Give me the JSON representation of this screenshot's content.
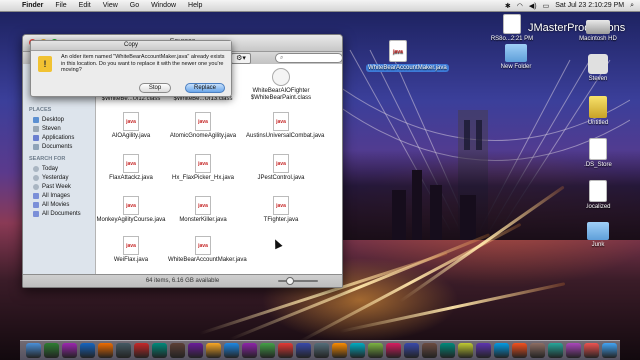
{
  "menubar": {
    "apple": "",
    "items": [
      "Finder",
      "File",
      "Edit",
      "View",
      "Go",
      "Window",
      "Help"
    ],
    "clock": "Sat Jul 23  2:10:29 PM"
  },
  "watermark": "JMasterProductions",
  "desktop_icons": [
    {
      "label": "RS8o...2:21 PM",
      "kind": "file"
    },
    {
      "label": "Macintosh HD",
      "kind": "drive"
    },
    {
      "label": "WhiteBearAccountMaker.java",
      "kind": "java",
      "selected": true
    },
    {
      "label": "New Folder",
      "kind": "folder"
    },
    {
      "label": "Steven",
      "kind": "home"
    },
    {
      "label": "Untitled",
      "kind": "drive"
    },
    {
      "label": ".DS_Store",
      "kind": "file"
    },
    {
      "label": ".localized",
      "kind": "file"
    },
    {
      "label": "Junk",
      "kind": "folder"
    }
  ],
  "finder": {
    "title": "Sources",
    "search_placeholder": "",
    "sidebar": {
      "places_header": "PLACES",
      "places": [
        "Desktop",
        "Steven",
        "Applications",
        "Documents"
      ],
      "search_header": "SEARCH FOR",
      "searches": [
        "Today",
        "Yesterday",
        "Past Week",
        "All Images",
        "All Movies",
        "All Documents"
      ]
    },
    "files": [
      {
        "name": "$WhiteBe...Ui12.class",
        "type": "class"
      },
      {
        "name": "$WhiteBe...UI13.class",
        "type": "class"
      },
      {
        "name": "WhiteBearAIOFighter $WhiteBearPaint.class",
        "type": "class"
      },
      {
        "name": "AIOAgility.java",
        "type": "java"
      },
      {
        "name": "AtomicGnomeAgility.java",
        "type": "java"
      },
      {
        "name": "AustinsUniversalCombat.java",
        "type": "java"
      },
      {
        "name": "FlaxAttackz.java",
        "type": "java"
      },
      {
        "name": "Hx_FlaxPicker_Hx.java",
        "type": "java"
      },
      {
        "name": "JPestControl.java",
        "type": "java"
      },
      {
        "name": "MonkeyAgilityCourse.java",
        "type": "java"
      },
      {
        "name": "MonsterKiller.java",
        "type": "java"
      },
      {
        "name": "TFighter.java",
        "type": "java"
      },
      {
        "name": "WeiFlax.java",
        "type": "java"
      },
      {
        "name": "WhiteBearAccountMaker.java",
        "type": "java"
      }
    ],
    "status": "64 items, 6.16 GB available"
  },
  "dialog": {
    "title": "Copy",
    "message": "An older item named \"WhiteBearAccountMaker.java\" already exists in this location. Do you want to replace it with the newer one you're moving?",
    "stop_label": "Stop",
    "replace_label": "Replace"
  },
  "icon_text": {
    "java": "java"
  },
  "dock_colors": [
    "#4a90d9",
    "#2e7d32",
    "#9c27b0",
    "#1565c0",
    "#ef6c00",
    "#455a64",
    "#c62828",
    "#00897b",
    "#5d4037",
    "#6a1b9a",
    "#f9a825",
    "#1e88e5",
    "#8e24aa",
    "#43a047",
    "#e53935",
    "#3949ab",
    "#546e7a",
    "#fb8c00",
    "#00acc1",
    "#7cb342",
    "#d81b60",
    "#3949ab",
    "#6d4c41",
    "#00897b",
    "#c0ca33",
    "#5e35b1",
    "#039be5",
    "#f4511e",
    "#8d6e63",
    "#26a69a",
    "#ab47bc",
    "#ef5350",
    "#42a5f5"
  ]
}
